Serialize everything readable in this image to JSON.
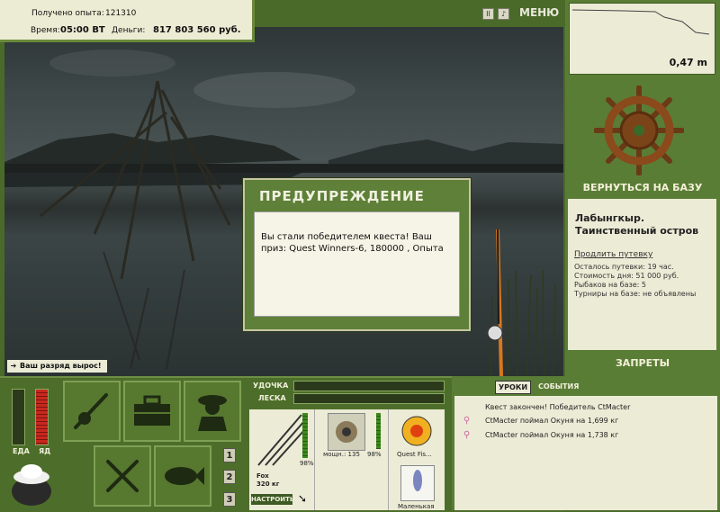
{
  "stats": {
    "exp_label": "Получено опыта:",
    "exp_value": "121310",
    "time_label": "Время:",
    "time_value": "05:00 ВТ",
    "money_label": "Деньги:",
    "money_value": "817 803 560 руб."
  },
  "top_icons": [
    "pause-icon",
    "sound-icon"
  ],
  "menu_label": "МЕНЮ",
  "depth": {
    "value": "0,47 m"
  },
  "right": {
    "return_label": "ВЕРНУТЬСЯ НА БАЗУ",
    "location_line1": "Лабынгкыр.",
    "location_line2": "Таинственный остров",
    "extend_link": "Продлить путевку",
    "remaining": "Осталось путевки: 19 час.",
    "day_cost": "Стоимость дня: 51 000 руб.",
    "fishers": "Рыбаков на базе: 5",
    "tournaments": "Турниры на базе: не объявлены",
    "bans_label": "ЗАПРЕТЫ"
  },
  "dialog": {
    "title": "ПРЕДУПРЕЖДЕНИЕ",
    "message": "Вы стали победителем квеста! Ваш приз: Quest Winners-6, 180000 , Опыта"
  },
  "rank_notice": "Ваш разряд вырос!",
  "meters": {
    "food_label": "ЕДА",
    "poison_label": "ЯД"
  },
  "bars": {
    "rod_label": "УДОЧКА",
    "line_label": "ЛЕСКА"
  },
  "tackle": {
    "rod_percent": "98%",
    "rod_name": "Fox",
    "rod_weight": "320 кг",
    "setup_label": "НАСТРОИТЬ",
    "reel_caption": "мощн.: 135",
    "reel_percent": "98%",
    "line_caption": "Quest Fis...",
    "lure_caption": "Маленькая"
  },
  "page_buttons": [
    "1",
    "2",
    "3"
  ],
  "events": {
    "tab_active": "УРОКИ",
    "tab_other": "СОБЫТИЯ",
    "items": [
      "Квест закончен! Победитель CtMacter",
      "CtMacter поймал Окуня на 1,699 кг",
      "CtMacter поймал Окуня на 1,738 кг"
    ]
  },
  "colors": {
    "panel_green": "#5a7d36",
    "panel_light": "#ecebd6",
    "accent_orange": "#e8801a"
  }
}
